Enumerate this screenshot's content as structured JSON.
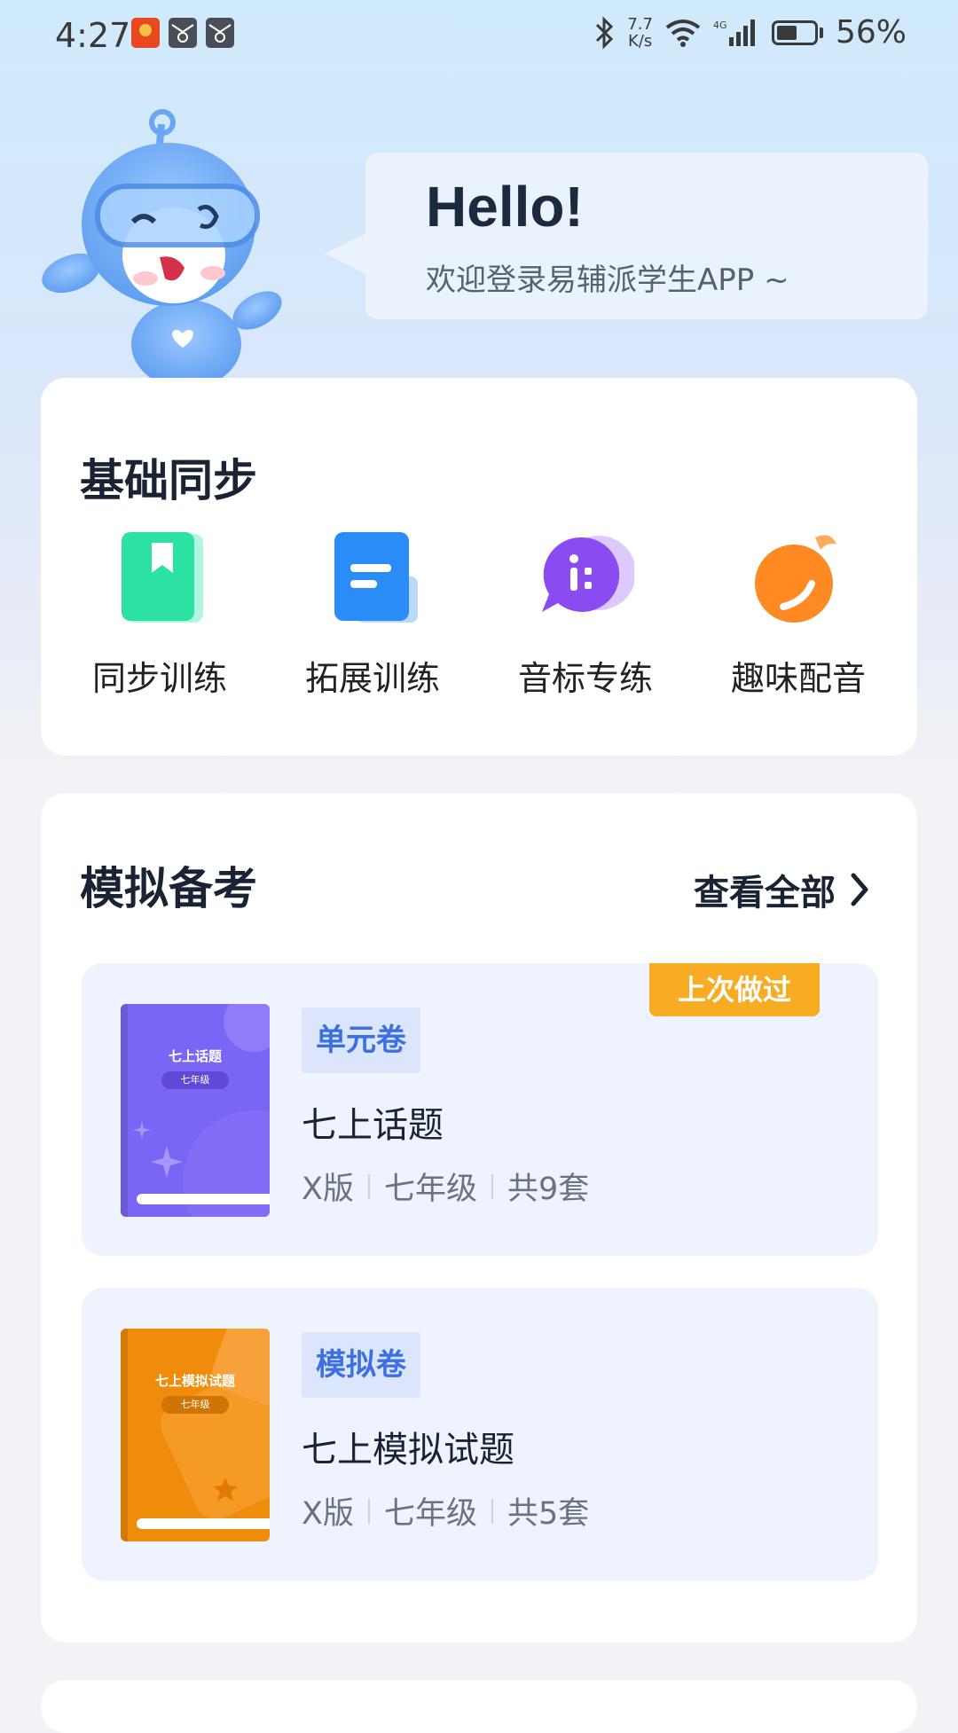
{
  "status_bar": {
    "time": "4:27",
    "speed_value": "7.7",
    "speed_unit": "K/s",
    "network": "4G",
    "battery_pct": "56%",
    "battery_level": 0.56
  },
  "header": {
    "greeting": "Hello!",
    "welcome": "欢迎登录易辅派学生APP ~"
  },
  "basic_sync": {
    "title": "基础同步",
    "items": [
      {
        "label": "同步训练",
        "icon": "bookmark-book-icon",
        "color": "#2ee6a6"
      },
      {
        "label": "拓展训练",
        "icon": "document-lines-icon",
        "color": "#2a8cf6"
      },
      {
        "label": "音标专练",
        "icon": "phonetic-chat-icon",
        "color": "#8a4cf0"
      },
      {
        "label": "趣味配音",
        "icon": "music-note-icon",
        "color": "#ff8a24"
      }
    ]
  },
  "mock_exam": {
    "title": "模拟备考",
    "view_all": "查看全部",
    "items": [
      {
        "cover_title": "七上话题",
        "cover_grade": "七年级",
        "tag": "单元卷",
        "name": "七上话题",
        "version": "X版",
        "grade": "七年级",
        "count": "共9套",
        "last_done": "上次做过",
        "cover_color": "#7a66f5"
      },
      {
        "cover_title": "七上模拟试题",
        "cover_grade": "七年级",
        "tag": "模拟卷",
        "name": "七上模拟试题",
        "version": "X版",
        "grade": "七年级",
        "count": "共5套",
        "cover_color": "#f08c0c"
      }
    ]
  }
}
